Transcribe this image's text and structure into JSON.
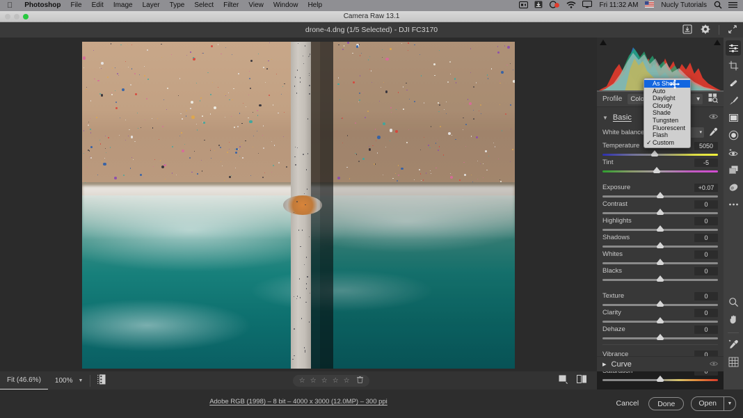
{
  "menubar": {
    "apple_icon": "apple-icon",
    "items": [
      {
        "label": "Photoshop",
        "bold": true
      },
      {
        "label": "File",
        "bold": false
      },
      {
        "label": "Edit",
        "bold": false
      },
      {
        "label": "Image",
        "bold": false
      },
      {
        "label": "Layer",
        "bold": false
      },
      {
        "label": "Type",
        "bold": false
      },
      {
        "label": "Select",
        "bold": false
      },
      {
        "label": "Filter",
        "bold": false
      },
      {
        "label": "View",
        "bold": false
      },
      {
        "label": "Window",
        "bold": false
      },
      {
        "label": "Help",
        "bold": false
      }
    ],
    "status": {
      "screen_record_icon": "screen-record-icon",
      "download_icon": "download-icon",
      "battery_icon": "battery-icon",
      "wifi_icon": "wifi-icon",
      "airplay_icon": "airplay-icon",
      "clock": "Fri 11:32 AM",
      "flag_icon": "us-flag-icon",
      "user": "Nucly Tutorials",
      "search_icon": "search-icon",
      "control_center_icon": "control-center-icon"
    }
  },
  "window": {
    "title": "Camera Raw 13.1",
    "filename": "drone-4.dng (1/5 Selected)  -  DJI FC3170",
    "header_icons": {
      "save_icon": "save-image-icon",
      "settings_icon": "gear-icon",
      "fullscreen_icon": "fullscreen-icon"
    }
  },
  "panel": {
    "profile": {
      "label": "Profile",
      "value": "Color",
      "browse_icon": "profile-browser-icon"
    },
    "basic": {
      "title": "Basic",
      "chevron_icon": "chevron-down-icon",
      "eye_icon": "eye-icon"
    },
    "white_balance": {
      "label": "White balance",
      "value": "Custom",
      "dropper_icon": "eyedropper-icon",
      "options": [
        {
          "label": "As Shot",
          "selected": true,
          "checked": false
        },
        {
          "label": "Auto",
          "selected": false,
          "checked": false
        },
        {
          "label": "Daylight",
          "selected": false,
          "checked": false
        },
        {
          "label": "Cloudy",
          "selected": false,
          "checked": false
        },
        {
          "label": "Shade",
          "selected": false,
          "checked": false
        },
        {
          "label": "Tungsten",
          "selected": false,
          "checked": false
        },
        {
          "label": "Fluorescent",
          "selected": false,
          "checked": false
        },
        {
          "label": "Flash",
          "selected": false,
          "checked": false
        },
        {
          "label": "Custom",
          "selected": false,
          "checked": true
        }
      ]
    },
    "sliders": [
      {
        "name": "Temperature",
        "value": "5050",
        "pos": 45,
        "track": "temp"
      },
      {
        "name": "Tint",
        "value": "-5",
        "pos": 47,
        "track": "tint"
      },
      {
        "name": "Exposure",
        "value": "+0.07",
        "pos": 50,
        "track": "plain"
      },
      {
        "name": "Contrast",
        "value": "0",
        "pos": 50,
        "track": "plain"
      },
      {
        "name": "Highlights",
        "value": "0",
        "pos": 50,
        "track": "plain"
      },
      {
        "name": "Shadows",
        "value": "0",
        "pos": 50,
        "track": "plain"
      },
      {
        "name": "Whites",
        "value": "0",
        "pos": 50,
        "track": "plain"
      },
      {
        "name": "Blacks",
        "value": "0",
        "pos": 50,
        "track": "plain"
      },
      {
        "name": "Texture",
        "value": "0",
        "pos": 50,
        "track": "plain"
      },
      {
        "name": "Clarity",
        "value": "0",
        "pos": 50,
        "track": "plain"
      },
      {
        "name": "Dehaze",
        "value": "0",
        "pos": 50,
        "track": "plain"
      },
      {
        "name": "Vibrance",
        "value": "0",
        "pos": 50,
        "track": "vib"
      },
      {
        "name": "Saturation",
        "value": "0",
        "pos": 50,
        "track": "vib"
      }
    ],
    "curve": {
      "title": "Curve",
      "chevron_icon": "chevron-right-icon",
      "eye_icon": "eye-icon"
    }
  },
  "tool_rail": {
    "tools": [
      {
        "name": "edit-tool",
        "icon": "sliders-icon",
        "active": true
      },
      {
        "name": "crop-tool",
        "icon": "crop-icon",
        "active": false
      },
      {
        "name": "healing-tool",
        "icon": "healing-brush-icon",
        "active": false
      },
      {
        "name": "adjustment-brush-tool",
        "icon": "brush-icon",
        "active": false
      },
      {
        "name": "graduated-filter-tool",
        "icon": "gradient-icon",
        "active": false
      },
      {
        "name": "radial-filter-tool",
        "icon": "radial-icon",
        "active": false
      },
      {
        "name": "red-eye-tool",
        "icon": "red-eye-icon",
        "active": false
      },
      {
        "name": "presets-tool",
        "icon": "presets-icon",
        "active": false
      },
      {
        "name": "snapshots-tool",
        "icon": "snapshot-icon",
        "active": false
      },
      {
        "name": "more-tool",
        "icon": "ellipsis-icon",
        "active": false
      }
    ],
    "bottom_tools": [
      {
        "name": "zoom-tool",
        "icon": "magnifier-icon"
      },
      {
        "name": "hand-tool",
        "icon": "hand-icon"
      },
      {
        "name": "white-balance-tool",
        "icon": "eyedropper-icon"
      },
      {
        "name": "grid-overlay-tool",
        "icon": "grid-icon"
      }
    ]
  },
  "bottom_toolbar": {
    "zoom_fit": "Fit (46.6%)",
    "zoom_percent": "100%",
    "zoom_caret_icon": "chevron-down-icon",
    "filmstrip_icon": "filmstrip-icon",
    "rating": {
      "stars": 5,
      "filled": 0,
      "reject_icon": "reject-icon"
    },
    "view_single_icon": "single-view-icon",
    "view_compare_icon": "compare-view-icon"
  },
  "status": {
    "info": "Adobe RGB (1998) – 8 bit – 4000 x 3000 (12.0MP) – 300 ppi"
  },
  "footer": {
    "cancel": "Cancel",
    "done": "Done",
    "open": "Open",
    "open_caret_icon": "chevron-down-icon"
  },
  "colors": {
    "accent_blue": "#1266e0",
    "panel_bg": "#383838",
    "rail_bg": "#404040",
    "canvas_bg": "#2b2b2b",
    "menu_bg": "#8f8f93"
  }
}
